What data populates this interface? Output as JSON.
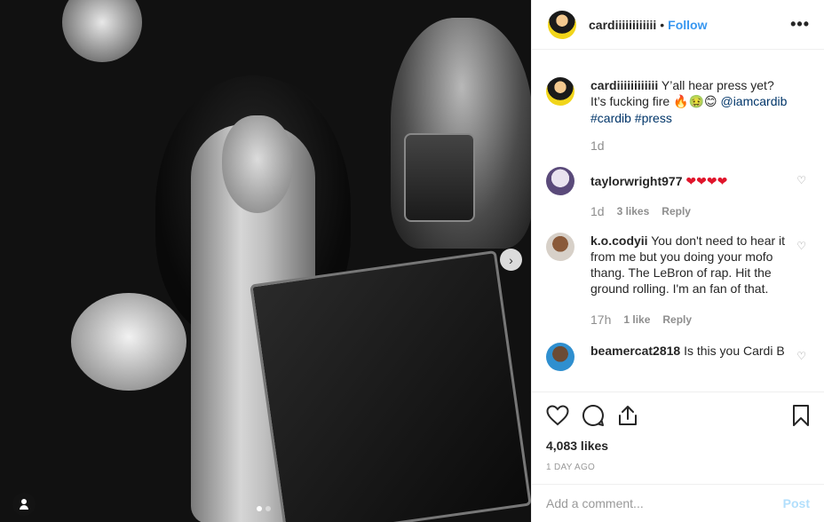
{
  "post": {
    "author": "cardiiiiiiiiiiii",
    "follow_label": "Follow",
    "separator": "•",
    "more_label": "•••",
    "carousel_next": "›",
    "caption": {
      "username": "cardiiiiiiiiiiii",
      "text_1": "Y’all hear press yet? It’s fucking fire ",
      "emojis": "🔥🤢😊",
      "mention": "@iamcardib",
      "hashtags": "#cardib #press",
      "time": "1d"
    }
  },
  "comments": [
    {
      "username": "taylorwright977",
      "text": "❤❤❤❤",
      "time": "1d",
      "likes": "3 likes",
      "reply": "Reply"
    },
    {
      "username": "k.o.codyii",
      "text": "You don't need to hear it from me but you doing your mofo thang. The LeBron of rap. Hit the ground rolling. I'm an fan of that.",
      "time": "17h",
      "likes": "1 like",
      "reply": "Reply"
    },
    {
      "username": "beamercat2818",
      "text": "Is this you Cardi B"
    }
  ],
  "engagement": {
    "likes": "4,083 likes",
    "date": "1 DAY AGO"
  },
  "add_comment": {
    "placeholder": "Add a comment...",
    "post_label": "Post"
  },
  "carousel": {
    "count": 2,
    "active": 0
  }
}
